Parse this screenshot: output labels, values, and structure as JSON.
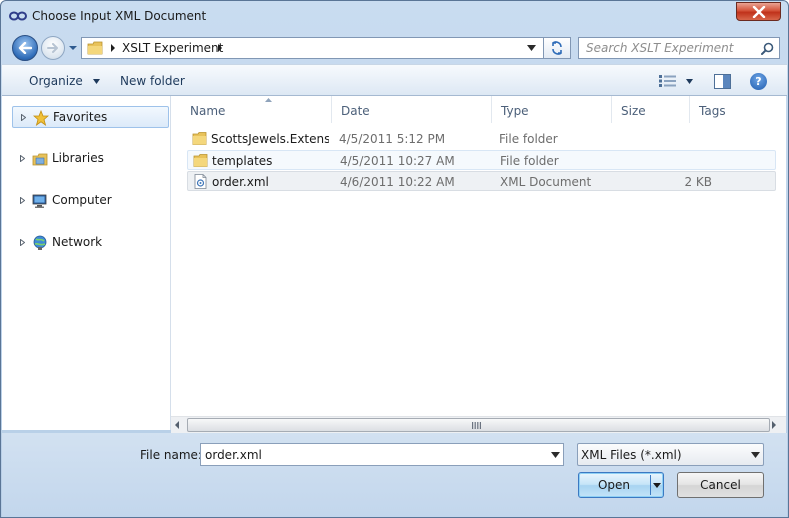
{
  "window": {
    "title": "Choose Input XML Document"
  },
  "address": {
    "crumb": "XSLT Experiment"
  },
  "search": {
    "placeholder": "Search XSLT Experiment"
  },
  "toolbar": {
    "organize_label": "Organize",
    "new_folder_label": "New folder",
    "help_label": "?"
  },
  "nav": {
    "items": [
      {
        "label": "Favorites",
        "icon": "star-icon"
      },
      {
        "label": "Libraries",
        "icon": "libraries-icon"
      },
      {
        "label": "Computer",
        "icon": "computer-icon"
      },
      {
        "label": "Network",
        "icon": "network-icon"
      }
    ]
  },
  "columns": {
    "name": "Name",
    "date": "Date",
    "type": "Type",
    "size": "Size",
    "tags": "Tags"
  },
  "files": [
    {
      "name": "ScottsJewels.Extensi...",
      "date": "4/5/2011 5:12 PM",
      "type": "File folder",
      "size": "",
      "icon": "folder-icon"
    },
    {
      "name": "templates",
      "date": "4/5/2011 10:27 AM",
      "type": "File folder",
      "size": "",
      "icon": "folder-icon"
    },
    {
      "name": "order.xml",
      "date": "4/6/2011 10:22 AM",
      "type": "XML Document",
      "size": "2 KB",
      "icon": "xml-file-icon"
    }
  ],
  "footer": {
    "file_name_label": "File name:",
    "file_name_value": "order.xml",
    "filter_value": "XML Files (*.xml)",
    "open_label": "Open",
    "cancel_label": "Cancel"
  },
  "colors": {
    "accent": "#3b79c2",
    "close": "#c0321b",
    "folder": "#e8c25a"
  }
}
